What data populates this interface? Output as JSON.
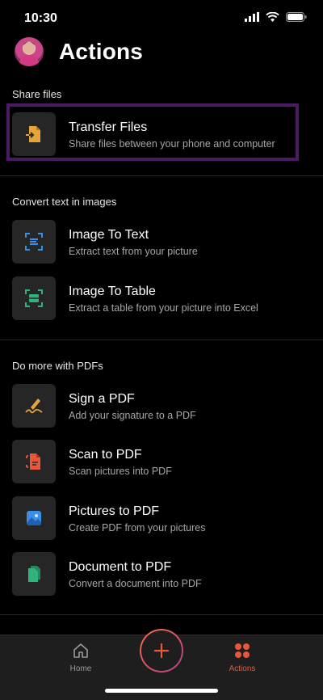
{
  "status_bar": {
    "time": "10:30"
  },
  "header": {
    "title": "Actions"
  },
  "sections": [
    {
      "title": "Share files",
      "items": [
        {
          "title": "Transfer Files",
          "subtitle": "Share files between your phone and computer",
          "icon": "transfer-icon",
          "color": "#e8a33a"
        }
      ]
    },
    {
      "title": "Convert text in images",
      "items": [
        {
          "title": "Image To Text",
          "subtitle": "Extract text from your picture",
          "icon": "image-to-text-icon",
          "color": "#3a8ee6"
        },
        {
          "title": "Image To Table",
          "subtitle": "Extract a table from your picture into Excel",
          "icon": "image-to-table-icon",
          "color": "#2fb37a"
        }
      ]
    },
    {
      "title": "Do more with PDFs",
      "items": [
        {
          "title": "Sign a PDF",
          "subtitle": "Add your signature to a PDF",
          "icon": "signature-icon",
          "color": "#e8a33a"
        },
        {
          "title": "Scan to PDF",
          "subtitle": "Scan pictures into PDF",
          "icon": "scan-pdf-icon",
          "color": "#e8573a"
        },
        {
          "title": "Pictures to PDF",
          "subtitle": "Create PDF from your pictures",
          "icon": "pictures-icon",
          "color": "#3a8ee6"
        },
        {
          "title": "Document to PDF",
          "subtitle": "Convert a document into PDF",
          "icon": "document-icon",
          "color": "#2fb37a"
        }
      ]
    }
  ],
  "tab_bar": {
    "tabs": [
      {
        "label": "Home",
        "icon": "home-icon",
        "active": false
      },
      {
        "label": "Actions",
        "icon": "grid-icon",
        "active": true
      }
    ],
    "fab_icon": "plus-icon"
  },
  "colors": {
    "accent": "#e8573a",
    "highlight_border": "#4a1a62",
    "inactive_tab": "#9a9a9a"
  }
}
